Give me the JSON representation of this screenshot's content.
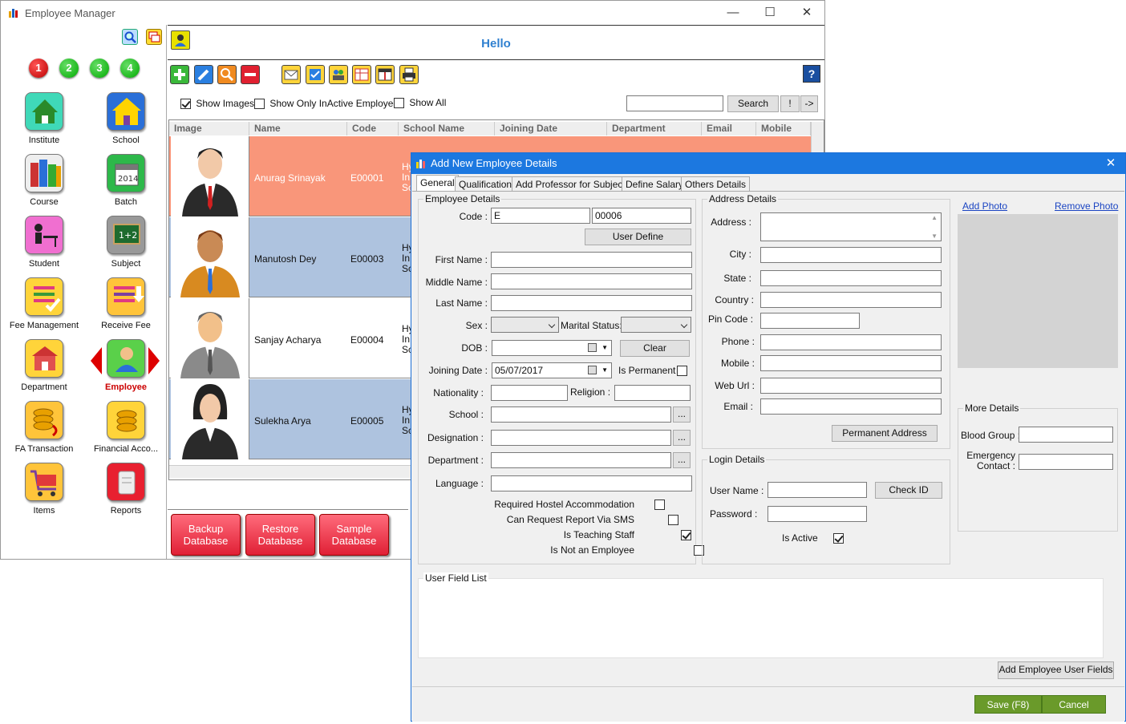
{
  "window": {
    "title": "Employee Manager"
  },
  "left_panel": {
    "number_buttons": [
      "1",
      "2",
      "3",
      "4"
    ],
    "modules": [
      {
        "label": "Institute",
        "icon": "house-icon"
      },
      {
        "label": "School",
        "icon": "school-icon"
      },
      {
        "label": "Course",
        "icon": "books-icon"
      },
      {
        "label": "Batch",
        "icon": "calendar-icon"
      },
      {
        "label": "Student",
        "icon": "student-desk-icon"
      },
      {
        "label": "Subject",
        "icon": "chalkboard-icon"
      },
      {
        "label": "Fee Management",
        "icon": "fee-list-icon"
      },
      {
        "label": "Receive Fee",
        "icon": "receive-fee-icon"
      },
      {
        "label": "Department",
        "icon": "department-icon"
      },
      {
        "label": "Employee",
        "icon": "employee-icon",
        "active": true
      },
      {
        "label": "FA Transaction",
        "icon": "coins-icon"
      },
      {
        "label": "Financial Acco...",
        "icon": "coins-stack-icon"
      },
      {
        "label": "Items",
        "icon": "cart-icon"
      },
      {
        "label": "Reports",
        "icon": "scroll-icon"
      }
    ]
  },
  "header": {
    "greeting": "Hello"
  },
  "filters": {
    "show_images": "Show Images",
    "show_inactive": "Show Only InActive Employee",
    "show_all": "Show All",
    "search_button": "Search",
    "exclaim_button": "!",
    "arrow_button": "->"
  },
  "grid": {
    "columns": [
      "Image",
      "Name",
      "Code",
      "School Name",
      "Joining Date",
      "Department",
      "Email",
      "Mobile"
    ],
    "rows": [
      {
        "name": "Anurag Srinayak",
        "code": "E00001",
        "school": "Hy In Sc"
      },
      {
        "name": "Manutosh Dey",
        "code": "E00003",
        "school": "Hy In Sc"
      },
      {
        "name": "Sanjay Acharya",
        "code": "E00004",
        "school": "Hy In Sc"
      },
      {
        "name": "Sulekha Arya",
        "code": "E00005",
        "school": "Hy In Sc"
      }
    ]
  },
  "bottom_buttons": [
    {
      "line1": "Backup",
      "line2": "Database"
    },
    {
      "line1": "Restore",
      "line2": "Database"
    },
    {
      "line1": "Sample",
      "line2": "Database"
    }
  ],
  "dialog": {
    "title": "Add New Employee Details",
    "tabs": [
      "General",
      "Qualification",
      "Add Professor for Subjects",
      "Define Salary",
      "Others Details"
    ],
    "employee_details": {
      "group_title": "Employee Details",
      "code_label": "Code :",
      "code_prefix": "E",
      "code_number": "00006",
      "user_define": "User Define",
      "first_name": "First Name :",
      "middle_name": "Middle Name :",
      "last_name": "Last Name :",
      "sex": "Sex :",
      "marital_status": "Marital Status:",
      "dob": "DOB :",
      "clear": "Clear",
      "joining_date": "Joining Date :",
      "joining_date_value": "05/07/2017",
      "is_permanent": "Is Permanent",
      "nationality": "Nationality :",
      "religion": "Religion :",
      "school": "School :",
      "designation": "Designation :",
      "department": "Department :",
      "language": "Language :",
      "browse": "...",
      "hostel": "Required Hostel Accommodation",
      "sms": "Can Request Report Via SMS",
      "teaching": "Is Teaching Staff",
      "not_employee": "Is Not an Employee"
    },
    "address_details": {
      "group_title": "Address Details",
      "address": "Address :",
      "city": "City :",
      "state": "State :",
      "country": "Country :",
      "pin_code": "Pin Code :",
      "phone": "Phone :",
      "mobile": "Mobile :",
      "web_url": "Web Url :",
      "email": "Email :",
      "permanent_address": "Permanent Address"
    },
    "login_details": {
      "group_title": "Login Details",
      "user_name": "User Name :",
      "check_id": "Check ID",
      "password": "Password :",
      "is_active": "Is Active"
    },
    "photo": {
      "add": "Add Photo",
      "remove": "Remove Photo"
    },
    "more_details": {
      "group_title": "More Details",
      "blood_group": "Blood Group :",
      "emergency_line1": "Emergency",
      "emergency_line2": "Contact :"
    },
    "user_field_list": "User Field List",
    "add_user_fields": "Add Employee User Fields",
    "save": "Save (F8)",
    "cancel": "Cancel"
  },
  "colors": {
    "selected_row": "#f9967a",
    "alt_row": "#aec3df",
    "dialog_title": "#1c78e0",
    "hello_text": "#2f80d0",
    "db_buttons": "#e83040"
  }
}
